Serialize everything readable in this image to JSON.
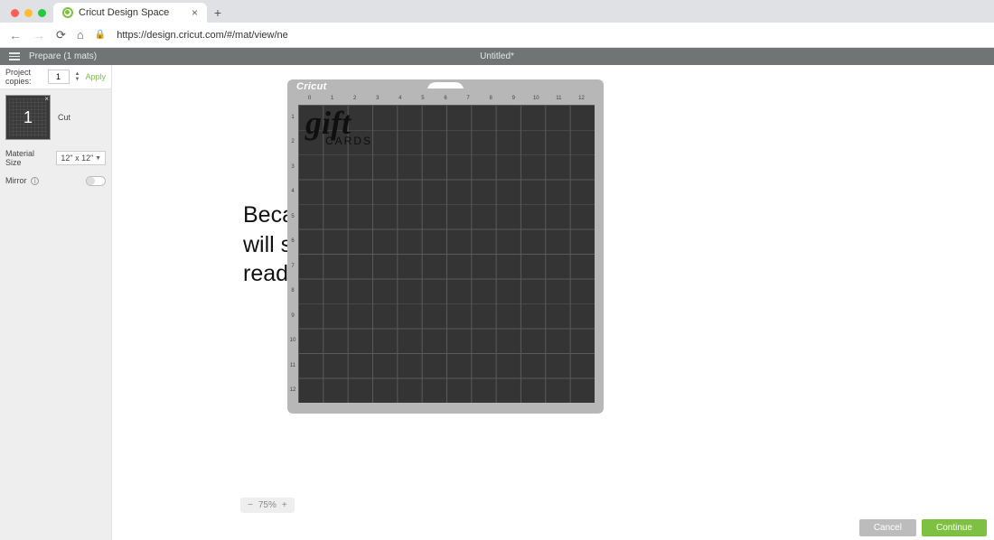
{
  "browser": {
    "tab_title": "Cricut Design Space",
    "url": "https://design.cricut.com/#/mat/view/ne"
  },
  "toolbar": {
    "title": "Prepare (1 mats)",
    "project_name": "Untitled*"
  },
  "sidebar": {
    "project_copies_label": "Project copies:",
    "project_copies_value": "1",
    "apply_label": "Apply",
    "mat_number": "1",
    "cut_label": "Cut",
    "material_size_label": "Material Size",
    "material_size_value": "12\" x 12\"",
    "mirror_label": "Mirror"
  },
  "mat": {
    "brand": "Cricut",
    "ruler_ticks": [
      "0",
      "1",
      "2",
      "3",
      "4",
      "5",
      "6",
      "7",
      "8",
      "9",
      "10",
      "11",
      "12"
    ],
    "design_word1": "gift",
    "design_word2": "CARDS"
  },
  "annotation": {
    "text": "Because it's attached, it will show up together and ready to be cut"
  },
  "zoom": {
    "minus": "−",
    "value": "75%",
    "plus": "+"
  },
  "footer": {
    "cancel": "Cancel",
    "continue": "Continue"
  }
}
